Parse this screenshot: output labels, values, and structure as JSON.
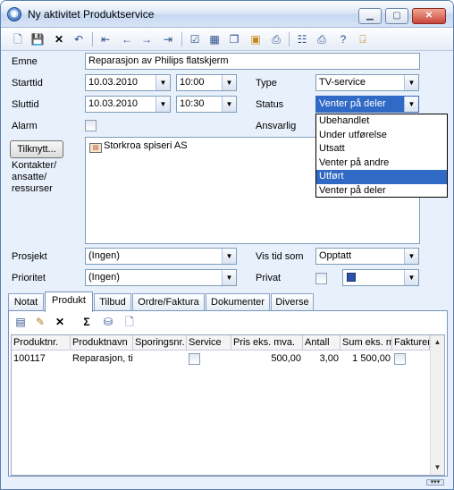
{
  "window": {
    "title": "Ny aktivitet Produktservice",
    "controls": {
      "minimize": "▁",
      "maximize": "▢",
      "close": "✕"
    }
  },
  "toolbar": {
    "icons": [
      "new-icon",
      "save-icon",
      "delete-icon",
      "undo-icon",
      "first-icon",
      "previous-icon",
      "next-icon",
      "last-icon",
      "check-icon",
      "calendar-icon",
      "copy-icon",
      "folder-icon",
      "print-icon",
      "properties-icon",
      "printer-icon",
      "help-icon",
      "exit-icon"
    ]
  },
  "form": {
    "emne_label": "Emne",
    "emne_value": "Reparasjon av Philips flatskjerm",
    "starttid_label": "Starttid",
    "starttid_date": "10.03.2010",
    "starttid_time": "10:00",
    "sluttid_label": "Sluttid",
    "sluttid_date": "10.03.2010",
    "sluttid_time": "10:30",
    "type_label": "Type",
    "type_value": "TV-service",
    "status_label": "Status",
    "status_value": "Venter på deler",
    "alarm_label": "Alarm",
    "ansvarlig_label": "Ansvarlig",
    "tilknytt_button": "Tilknytt...",
    "kontakter_label_1": "Kontakter/",
    "kontakter_label_2": "ansatte/",
    "kontakter_label_3": "ressurser",
    "contact_item": "Storkroa spiseri AS",
    "prosjekt_label": "Prosjekt",
    "prosjekt_value": "(Ingen)",
    "prioritet_label": "Prioritet",
    "prioritet_value": "(Ingen)",
    "vis_tid_som_label": "Vis tid som",
    "vis_tid_som_value": "Opptatt",
    "privat_label": "Privat",
    "color_value": "#2d50a8"
  },
  "status_dropdown": {
    "options": [
      "Ubehandlet",
      "Under utførelse",
      "Utsatt",
      "Venter på andre",
      "Utført",
      "Venter på deler"
    ],
    "highlighted": "Utført"
  },
  "tabs": [
    "Notat",
    "Produkt",
    "Tilbud",
    "Ordre/Faktura",
    "Dokumenter",
    "Diverse"
  ],
  "active_tab": "Produkt",
  "product_toolbar": {
    "icons": [
      "add-product-icon",
      "edit-icon",
      "delete-icon",
      "sum-icon",
      "database-icon",
      "document-icon"
    ],
    "sum_symbol": "Σ"
  },
  "product_table": {
    "columns": [
      "Produktnr.",
      "Produktnavn",
      "Sporingsnr.",
      "Service",
      "Pris eks. mva.",
      "Antall",
      "Sum eks. mva.",
      "Fakturert"
    ],
    "rows": [
      {
        "produktnr": "100117",
        "produktnavn": "Reparasjon, ti",
        "sporingsnr": "",
        "service": false,
        "pris": "500,00",
        "antall": "3,00",
        "sum": "1 500,00",
        "fakturert": false
      }
    ]
  }
}
